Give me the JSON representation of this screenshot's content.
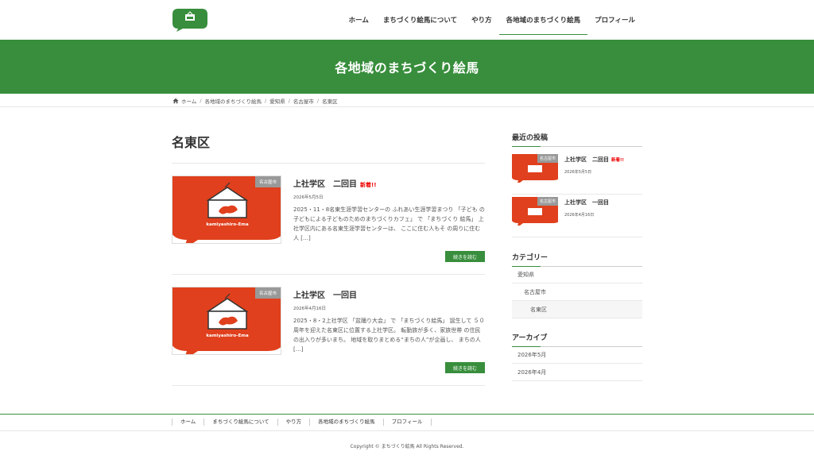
{
  "header": {
    "logo_alt": "kamiyashiro-Ema",
    "nav": [
      {
        "label": "ホーム"
      },
      {
        "label": "まちづくり絵馬について"
      },
      {
        "label": "やり方"
      },
      {
        "label": "各地域のまちづくり絵馬",
        "active": true
      },
      {
        "label": "プロフィール"
      }
    ]
  },
  "banner": {
    "title": "各地域のまちづくり絵馬"
  },
  "breadcrumb": [
    "ホーム",
    "各地域のまちづくり絵馬",
    "愛知県",
    "名古屋市",
    "名東区"
  ],
  "main": {
    "page_title": "名東区",
    "posts": [
      {
        "category": "名古屋市",
        "title": "上社学区　二回目",
        "new_label": "新着!!",
        "date": "2026年5月5日",
        "excerpt": "2025・11・8名東生涯学習センターの ふれあい生涯学習まつり 「子ども の子どもによる子どものためのまちづくりカフェ」 で 「まちづくり 絵馬」 上社学区内にある名東生涯学習センターは、 ここに住む人もそ の周りに住む人 […]",
        "more_label": "続きを読む",
        "thumb_text": "kamiyashiro-Ema"
      },
      {
        "category": "名古屋市",
        "title": "上社学区　一回目",
        "new_label": "",
        "date": "2026年4月16日",
        "excerpt": "2025・8・2上社学区 「盆踊り大会」 で 「まちづくり絵馬」 誕生して ５０周年を迎えた名東区に位置する上社学区。 転勤族が多く、家族世帯 の住民の出入りが多いまち。 地域を取りまとめる“まちの人”が企画し、 まちの人 […]",
        "more_label": "続きを読む",
        "thumb_text": "kamiyashiro-Ema"
      }
    ]
  },
  "sidebar": {
    "recent_heading": "最近の投稿",
    "recent_posts": [
      {
        "category": "名古屋市",
        "title": "上社学区　二回目",
        "new_label": "新着!!",
        "date": "2026年5月5日"
      },
      {
        "category": "名古屋市",
        "title": "上社学区　一回目",
        "new_label": "",
        "date": "2026年4月16日"
      }
    ],
    "category_heading": "カテゴリー",
    "categories": [
      {
        "label": "愛知県",
        "level": 0
      },
      {
        "label": "名古屋市",
        "level": 1
      },
      {
        "label": "名東区",
        "level": 2,
        "current": true
      }
    ],
    "archive_heading": "アーカイブ",
    "archives": [
      "2026年5月",
      "2026年4月"
    ]
  },
  "footer": {
    "nav": [
      "ホーム",
      "まちづくり絵馬について",
      "やり方",
      "各地域のまちづくり絵馬",
      "プロフィール"
    ],
    "copyright": "Copyright © まちづくり絵馬 All Rights Reserved."
  },
  "colors": {
    "accent": "#388e3c",
    "thumb_red": "#e0401d",
    "new_red": "#e00000",
    "badge_gray": "#999999"
  },
  "icons": {
    "home": "home-icon",
    "logo": "speech-bubble-ema-logo"
  }
}
